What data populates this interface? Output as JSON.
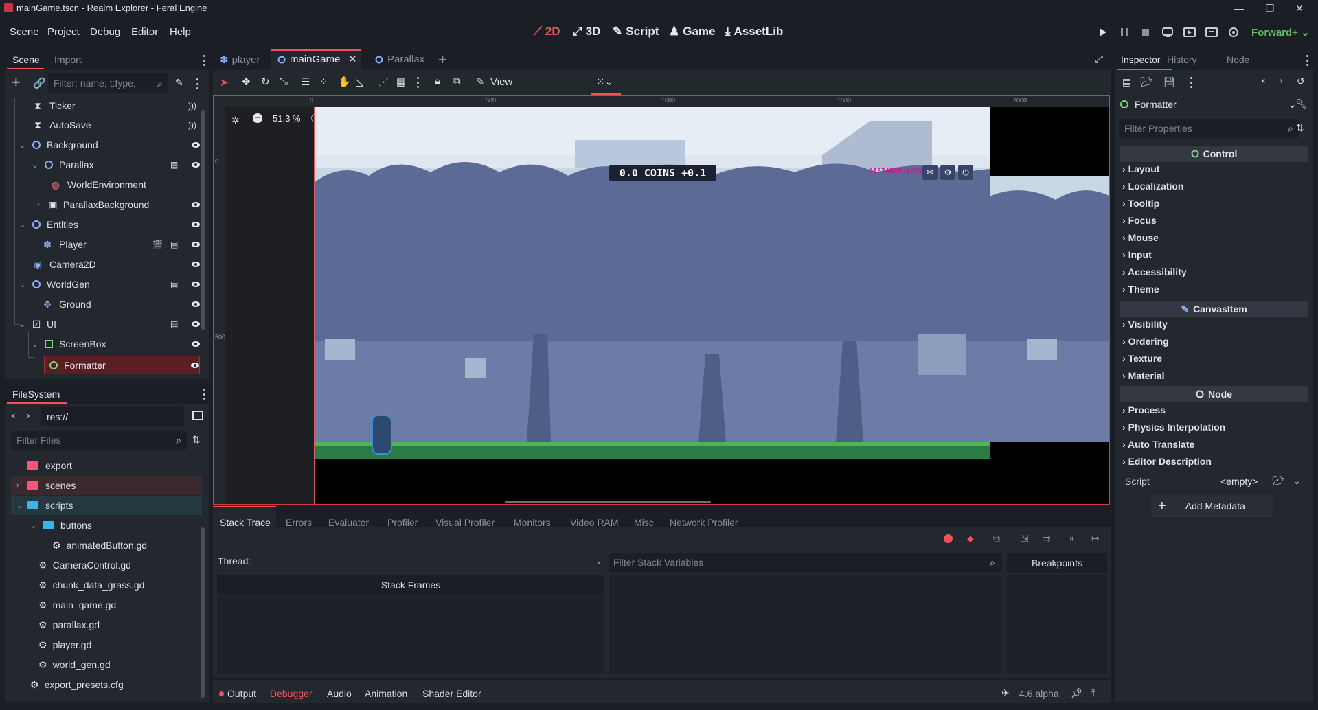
{
  "window": {
    "title": "mainGame.tscn - Realm Explorer - Feral Engine"
  },
  "menu": {
    "items": [
      "Scene",
      "Project",
      "Debug",
      "Editor",
      "Help"
    ]
  },
  "workspaces": [
    "2D",
    "3D",
    "Script",
    "Game",
    "AssetLib"
  ],
  "renderer": "Forward+",
  "scene_dock": {
    "tabs": [
      "Scene",
      "Import"
    ],
    "filter_placeholder": "Filter: name, t:type,",
    "nodes": [
      {
        "name": "Ticker",
        "icon": "timer-icon"
      },
      {
        "name": "AutoSave",
        "icon": "timer-icon"
      },
      {
        "name": "Background",
        "icon": "node-icon"
      },
      {
        "name": "Parallax",
        "icon": "node-icon"
      },
      {
        "name": "WorldEnvironment",
        "icon": "globe-icon"
      },
      {
        "name": "ParallaxBackground",
        "icon": "canvas-icon"
      },
      {
        "name": "Entities",
        "icon": "node-icon"
      },
      {
        "name": "Player",
        "icon": "character-icon"
      },
      {
        "name": "Camera2D",
        "icon": "camera-icon"
      },
      {
        "name": "WorldGen",
        "icon": "node-icon"
      },
      {
        "name": "Ground",
        "icon": "tilemap-icon"
      },
      {
        "name": "UI",
        "icon": "canvaslayer-icon"
      },
      {
        "name": "ScreenBox",
        "icon": "control-icon"
      },
      {
        "name": "Formatter",
        "icon": "control-icon"
      }
    ]
  },
  "filesystem": {
    "title": "FileSystem",
    "path": "res://",
    "filter_placeholder": "Filter Files",
    "items": [
      "export",
      "scenes",
      "scripts",
      "buttons",
      "animatedButton.gd",
      "CameraControl.gd",
      "chunk_data_grass.gd",
      "main_game.gd",
      "parallax.gd",
      "player.gd",
      "world_gen.gd",
      "export_presets.cfg"
    ]
  },
  "editor_tabs": [
    "player",
    "mainGame",
    "Parallax"
  ],
  "viewport": {
    "zoom": "51.3 %",
    "view_label": "View",
    "ruler": [
      "0",
      "500",
      "1000",
      "1500",
      "2000"
    ],
    "vruler": [
      "0",
      "500"
    ],
    "hud_coins": "0.0 COINS +0.1",
    "hud_distance": "DISTANCE:1682"
  },
  "debugger": {
    "tabs": [
      "Stack Trace",
      "Errors",
      "Evaluator",
      "Profiler",
      "Visual Profiler",
      "Monitors",
      "Video RAM",
      "Misc",
      "Network Profiler"
    ],
    "thread_label": "Thread:",
    "stack_frames": "Stack Frames",
    "filter_vars_placeholder": "Filter Stack Variables",
    "breakpoints": "Breakpoints"
  },
  "bottom_panel": {
    "tabs": [
      "Output",
      "Debugger",
      "Audio",
      "Animation",
      "Shader Editor"
    ],
    "version": "4.6.alpha"
  },
  "inspector": {
    "tabs": [
      "Inspector",
      "History",
      "Node"
    ],
    "node_name": "Formatter",
    "filter_placeholder": "Filter Properties",
    "control_header": "Control",
    "control_sections": [
      "Layout",
      "Localization",
      "Tooltip",
      "Focus",
      "Mouse",
      "Input",
      "Accessibility",
      "Theme"
    ],
    "canvas_header": "CanvasItem",
    "canvas_sections": [
      "Visibility",
      "Ordering",
      "Texture",
      "Material"
    ],
    "node_header": "Node",
    "node_sections": [
      "Process",
      "Physics Interpolation",
      "Auto Translate",
      "Editor Description"
    ],
    "script_label": "Script",
    "script_value": "<empty>",
    "add_metadata": "Add Metadata"
  },
  "colors": {
    "accent": "#f0535a",
    "bg": "#1b1e24",
    "panel": "#23272e",
    "selected": "#5a1f24",
    "scenes_row": "#3a2a30",
    "scripts_row": "#23383f"
  }
}
